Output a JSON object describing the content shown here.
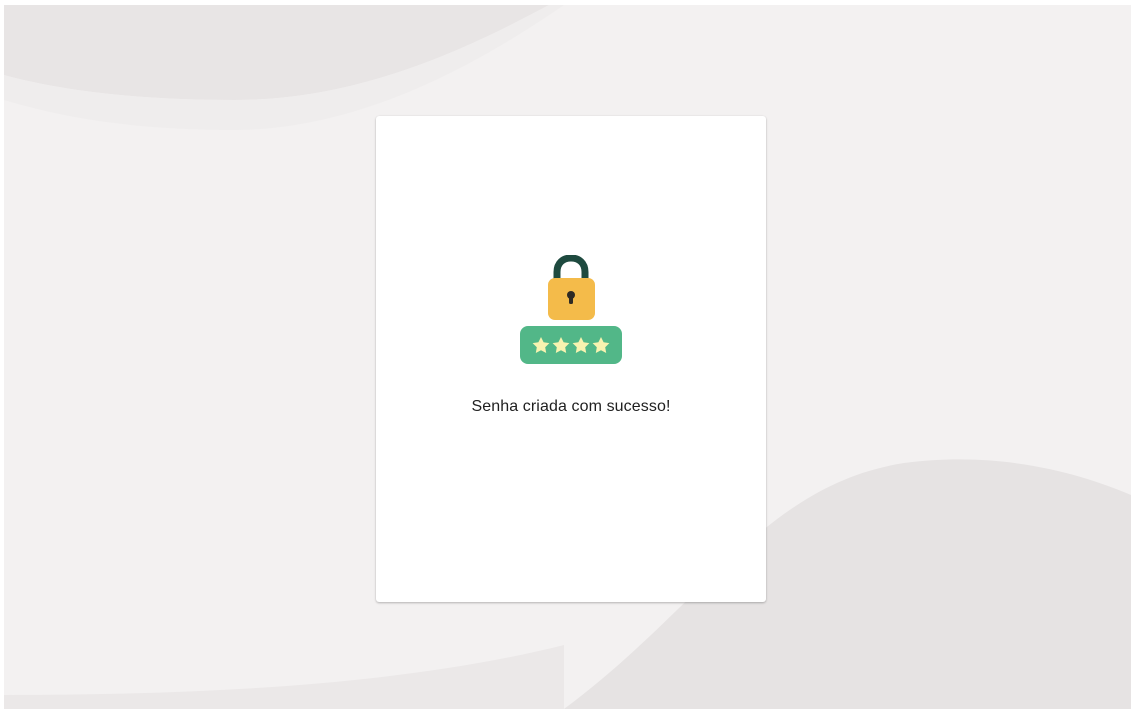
{
  "dialog": {
    "message": "Senha criada com sucesso!",
    "illustration_icon": "padlock-password-icon"
  },
  "colors": {
    "background": "#f3f1f1",
    "wave": "#e6e3e3",
    "card": "#ffffff",
    "lock_body": "#f4bb4a",
    "lock_shackle": "#1e4a3f",
    "password_field": "#52b788",
    "password_stars": "#f8f3b0",
    "text": "#1f1f1f"
  }
}
